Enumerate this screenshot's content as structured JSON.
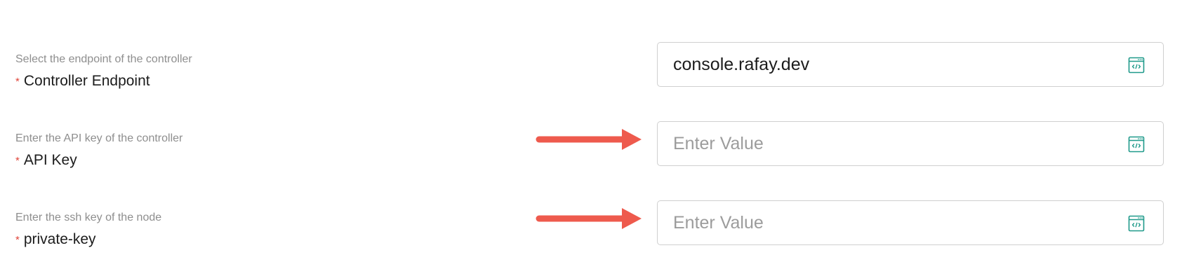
{
  "fields": [
    {
      "hint": "Select the endpoint of the controller",
      "required_mark": "*",
      "label": "Controller Endpoint",
      "value": "console.rafay.dev",
      "placeholder": "",
      "icon": "code-window-icon"
    },
    {
      "hint": "Enter the API key of the controller",
      "required_mark": "*",
      "label": "API Key",
      "value": "",
      "placeholder": "Enter Value",
      "icon": "code-window-icon"
    },
    {
      "hint": "Enter the ssh key of the node",
      "required_mark": "*",
      "label": "private-key",
      "value": "",
      "placeholder": "Enter Value",
      "icon": "code-window-icon"
    }
  ],
  "colors": {
    "required": "#e0453a",
    "accent_icon": "#1f9a8a",
    "annotation_arrow": "#ee5a4d"
  }
}
